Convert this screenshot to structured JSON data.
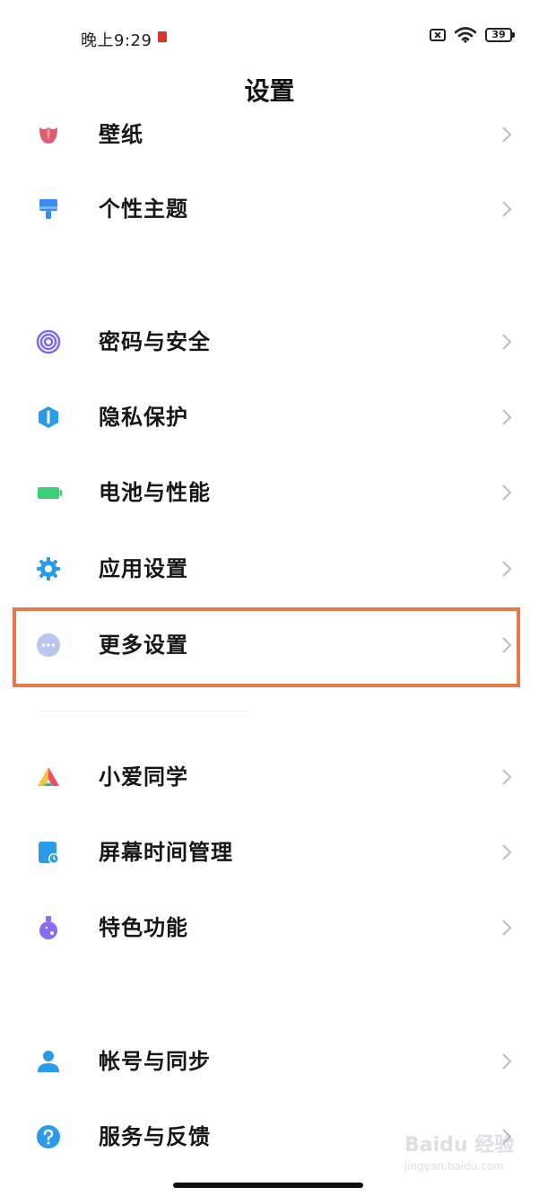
{
  "status_bar": {
    "time": "晚上9:29",
    "battery_level": "39"
  },
  "page": {
    "title": "设置"
  },
  "settings_items": [
    {
      "key": "wallpaper",
      "label": "壁纸",
      "icon": "tulip-icon",
      "color": "#e25a72"
    },
    {
      "key": "themes",
      "label": "个性主题",
      "icon": "paint-brush-icon",
      "color": "#3a8df0"
    },
    {
      "key": "passwords-security",
      "label": "密码与安全",
      "icon": "fingerprint-icon",
      "color": "#7a6cf0"
    },
    {
      "key": "privacy",
      "label": "隐私保护",
      "icon": "shield-icon",
      "color": "#2a9be8"
    },
    {
      "key": "battery",
      "label": "电池与性能",
      "icon": "battery-icon",
      "color": "#3fce7a"
    },
    {
      "key": "apps",
      "label": "应用设置",
      "icon": "gear-icon",
      "color": "#2a9be8"
    },
    {
      "key": "more-settings",
      "label": "更多设置",
      "icon": "more-dots-icon",
      "color": "#9fb2e8",
      "highlighted": true
    },
    {
      "key": "xiaoai",
      "label": "小爱同学",
      "icon": "xiaoai-icon",
      "color": "#f04e5e"
    },
    {
      "key": "screen-time",
      "label": "屏幕时间管理",
      "icon": "screen-time-icon",
      "color": "#2a9be8"
    },
    {
      "key": "features",
      "label": "特色功能",
      "icon": "flask-icon",
      "color": "#8a6cf0"
    },
    {
      "key": "account-sync",
      "label": "帐号与同步",
      "icon": "person-icon",
      "color": "#2a9be8"
    },
    {
      "key": "services-feedback",
      "label": "服务与反馈",
      "icon": "help-icon",
      "color": "#2a9be8"
    }
  ],
  "watermark": {
    "brand": "Baidu 经验",
    "url": "jingyan.baidu.com"
  }
}
